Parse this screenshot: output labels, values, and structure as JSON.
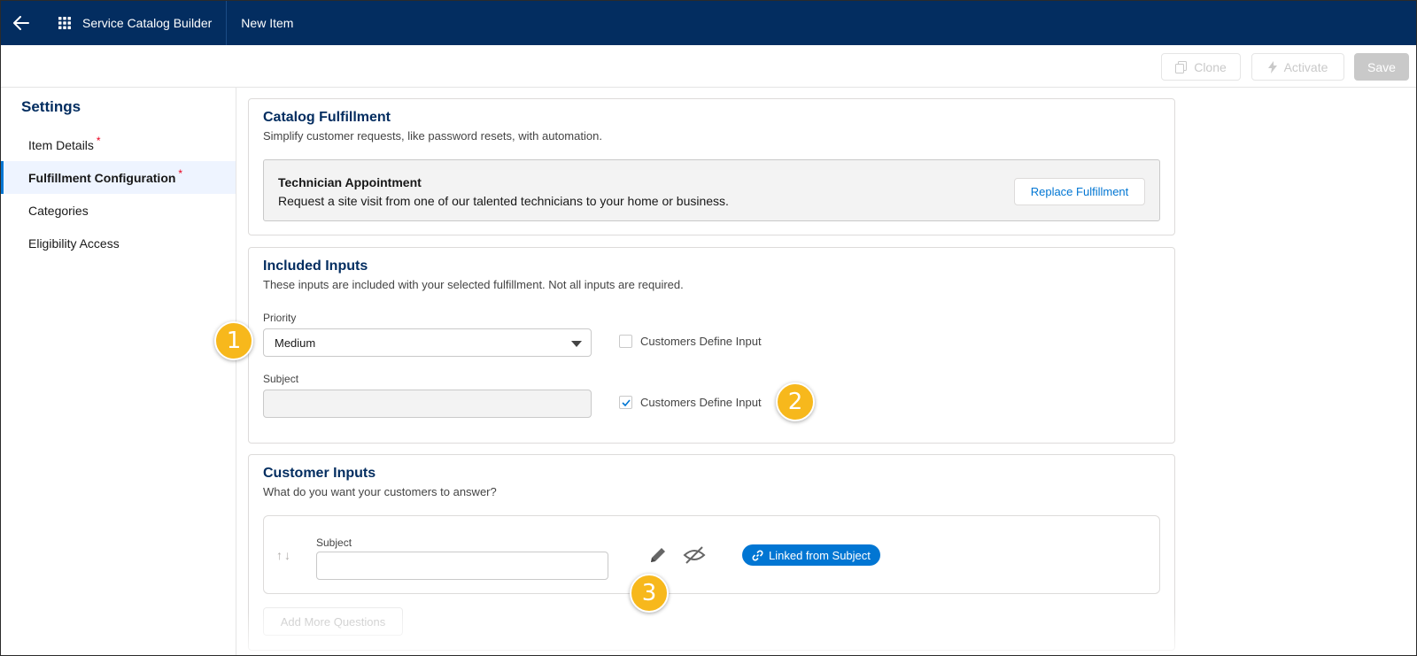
{
  "header": {
    "app_title": "Service Catalog Builder",
    "tab_label": "New Item",
    "bg_color": "#032d60"
  },
  "actions": {
    "clone_label": "Clone",
    "activate_label": "Activate",
    "save_label": "Save"
  },
  "sidebar": {
    "title": "Settings",
    "items": [
      {
        "label": "Item Details",
        "required": "*"
      },
      {
        "label": "Fulfillment Configuration",
        "required": "*"
      },
      {
        "label": "Categories"
      },
      {
        "label": "Eligibility Access"
      }
    ]
  },
  "catalog_fulfillment": {
    "title": "Catalog Fulfillment",
    "subtitle": "Simplify customer requests, like password resets, with automation.",
    "tech_title": "Technician Appointment",
    "tech_desc": "Request a site visit from one of our talented technicians to your home or business.",
    "replace_label": "Replace Fulfillment"
  },
  "included_inputs": {
    "title": "Included Inputs",
    "subtitle": "These inputs are included with your selected fulfillment. Not all inputs are required.",
    "priority_label": "Priority",
    "priority_value": "Medium",
    "subject_label": "Subject",
    "checkbox_label": "Customers Define Input",
    "checkbox_label_2": "Customers Define Input",
    "priority_checked": false,
    "subject_checked": true
  },
  "customer_inputs": {
    "title": "Customer Inputs",
    "subtitle": "What do you want your customers to answer?",
    "field_label": "Subject",
    "linked_label": "Linked from Subject",
    "add_more_label": "Add More Questions"
  },
  "callouts": [
    "1",
    "2",
    "3"
  ],
  "colors": {
    "accent": "#0176d3",
    "callout": "#f7b81c",
    "required": "#ea001e"
  }
}
